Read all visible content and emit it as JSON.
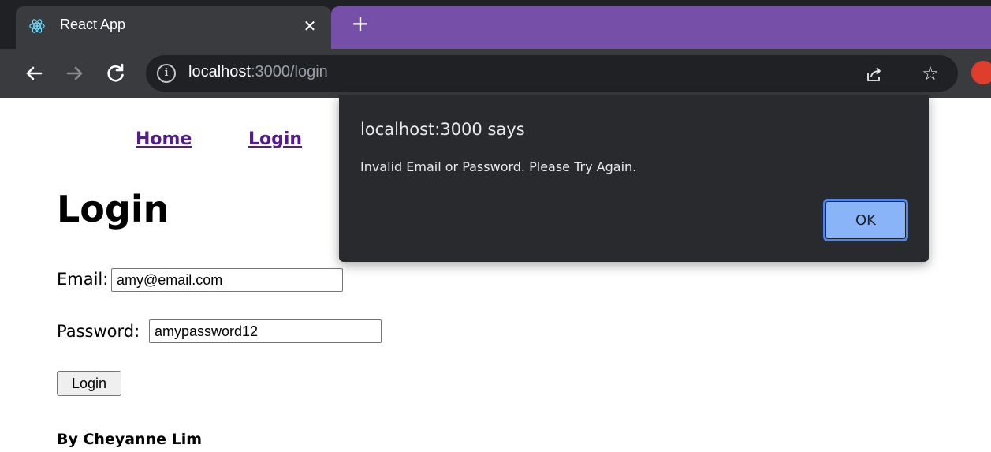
{
  "browser": {
    "tab_title": "React App",
    "close_glyph": "✕",
    "new_tab_glyph": "+",
    "url_host": "localhost",
    "url_rest": ":3000/login",
    "colors": {
      "tabstrip": "#202124",
      "accent": "#7650a8",
      "toolbar": "#3a3b3f"
    }
  },
  "nav": {
    "home": "Home",
    "login": "Login"
  },
  "page": {
    "heading": "Login",
    "email_label": "Email:",
    "email_value": "amy@email.com",
    "password_label": "Password:",
    "password_value": "amypassword12",
    "login_button": "Login",
    "byline": "By Cheyanne Lim"
  },
  "dialog": {
    "title": "localhost:3000 says",
    "message": "Invalid Email or Password. Please Try Again.",
    "ok_label": "OK"
  }
}
